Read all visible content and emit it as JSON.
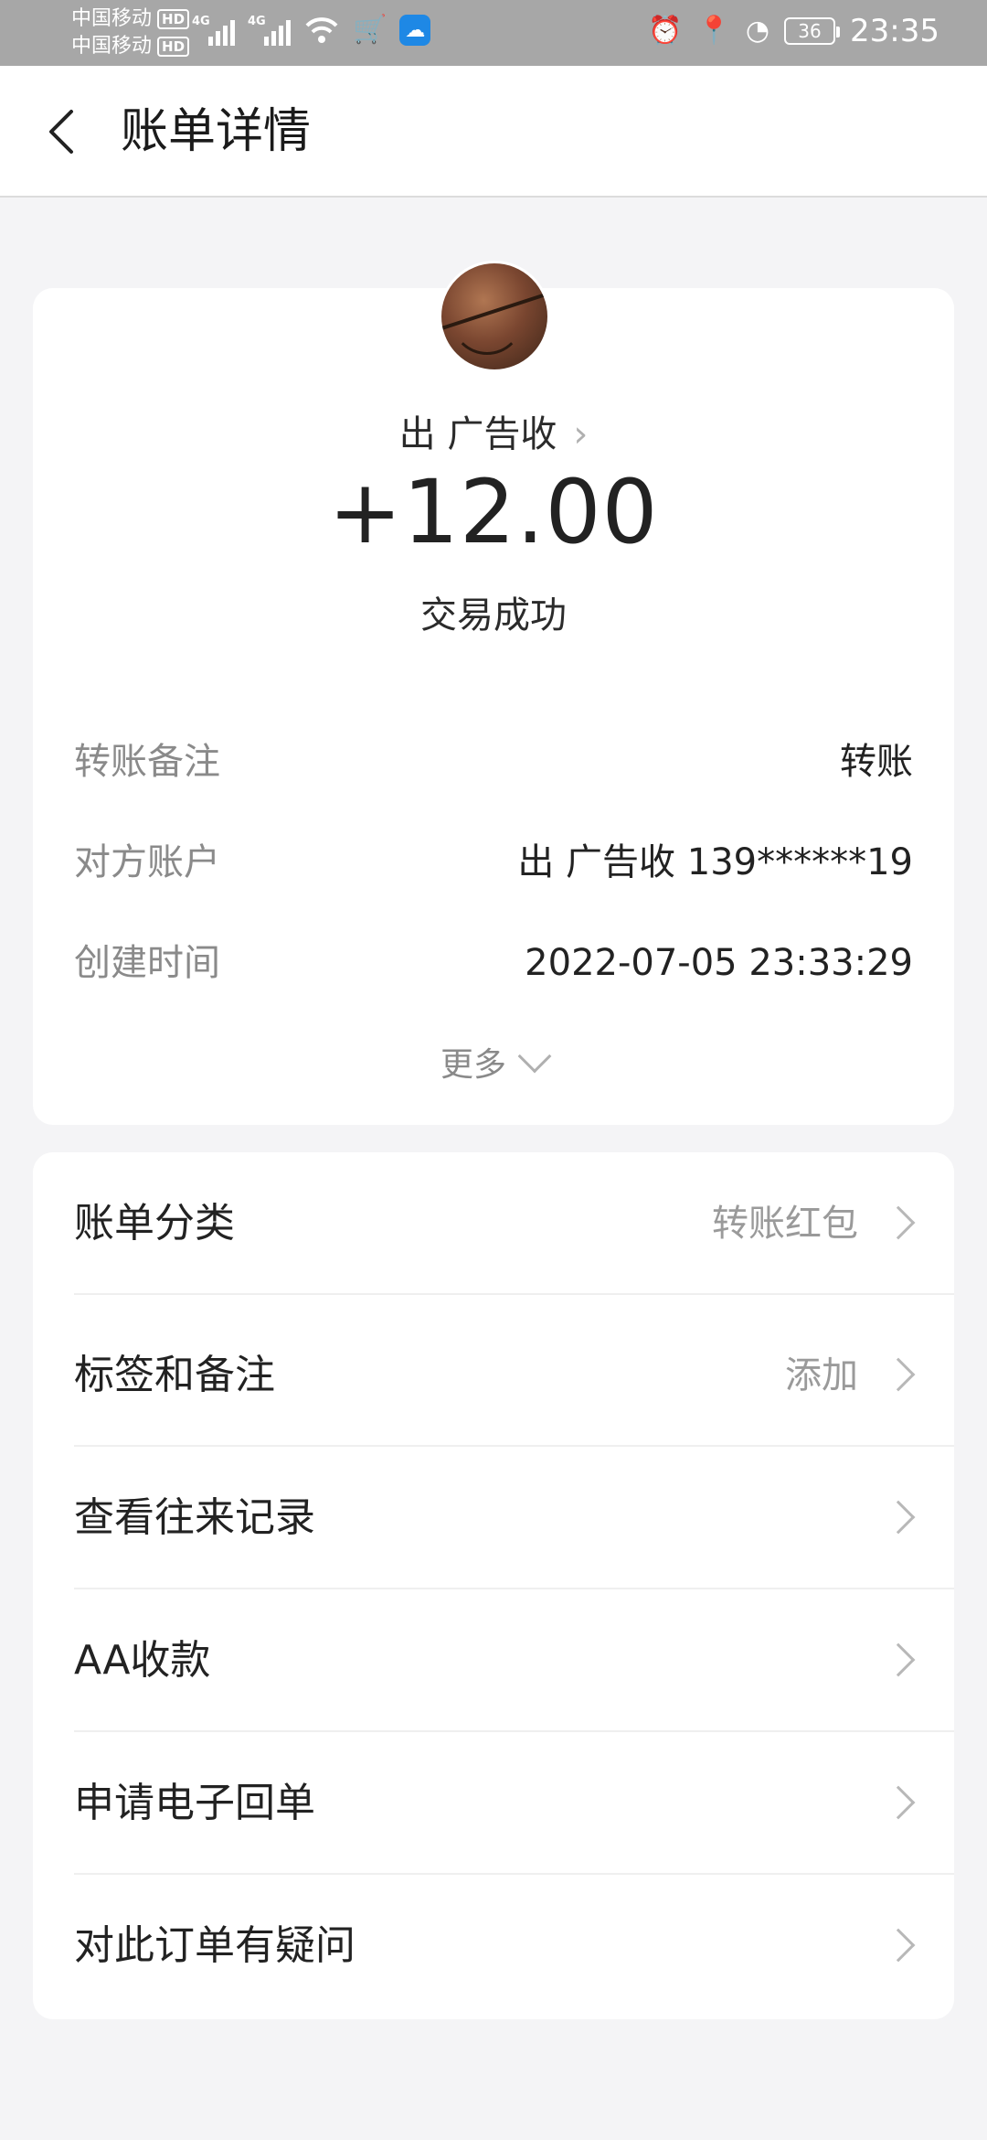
{
  "status_bar": {
    "carrier1": "中国移动",
    "carrier2": "中国移动",
    "hd": "HD",
    "net1": "4G",
    "net2": "4G",
    "battery": "36",
    "time": "23:35"
  },
  "header": {
    "title": "账单详情"
  },
  "transaction": {
    "payee": "出 广告收",
    "amount": "+12.00",
    "status": "交易成功",
    "details": [
      {
        "label": "转账备注",
        "value": "转账"
      },
      {
        "label": "对方账户",
        "value": "出 广告收 139******19"
      },
      {
        "label": "创建时间",
        "value": "2022-07-05 23:33:29"
      }
    ],
    "more_label": "更多"
  },
  "menu": [
    {
      "label": "账单分类",
      "value": "转账红包"
    },
    {
      "label": "标签和备注",
      "value": "添加"
    },
    {
      "label": "查看往来记录",
      "value": ""
    },
    {
      "label": "AA收款",
      "value": ""
    },
    {
      "label": "申请电子回单",
      "value": ""
    },
    {
      "label": "对此订单有疑问",
      "value": ""
    }
  ]
}
